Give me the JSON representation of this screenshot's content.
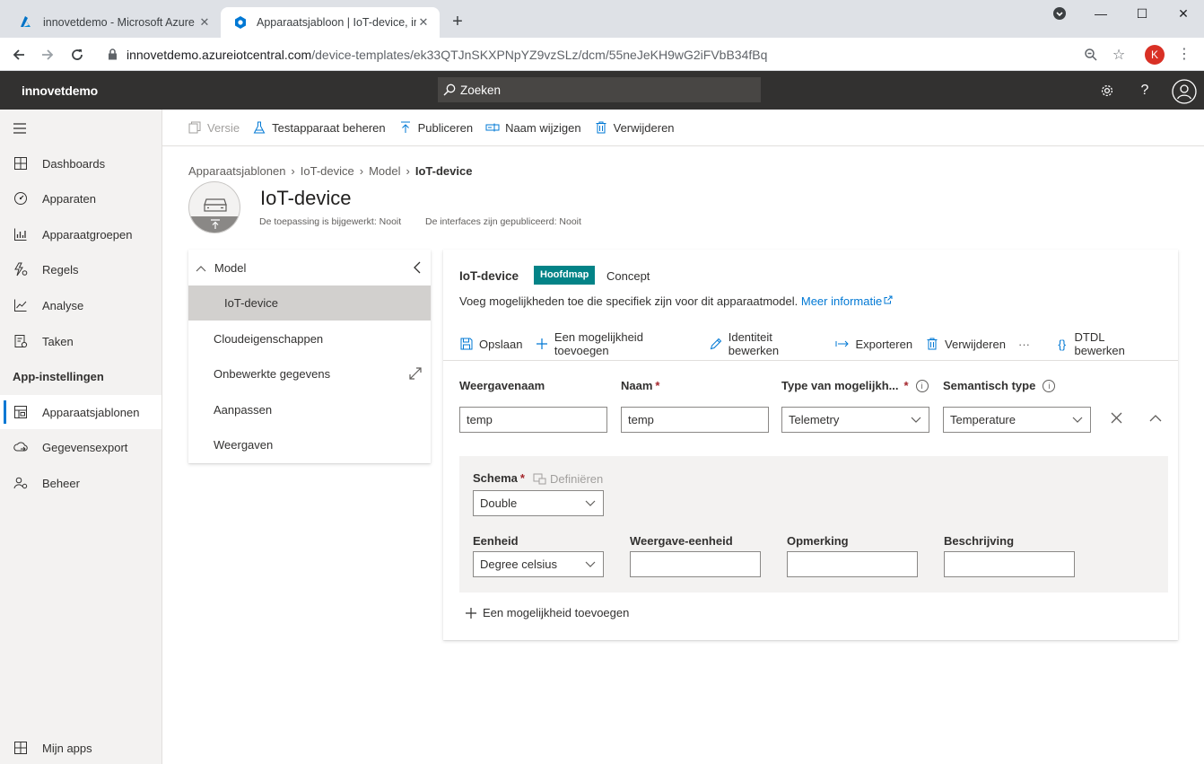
{
  "browser": {
    "tabs": [
      {
        "title": "innovetdemo - Microsoft Azure",
        "active": false
      },
      {
        "title": "Apparaatsjabloon | IoT-device, in",
        "active": true
      }
    ],
    "url_host": "innovetdemo.azureiotcentral.com",
    "url_path": "/device-templates/ek33QTJnSKXPNpYZ9vzSLz/dcm/55neJeKH9wG2iFVbB34fBq",
    "profile_initial": "K"
  },
  "app": {
    "name": "innovetdemo",
    "search_placeholder": "Zoeken"
  },
  "leftnav": {
    "items": [
      {
        "label": "Dashboards",
        "icon": "dashboard-icon"
      },
      {
        "label": "Apparaten",
        "icon": "devices-icon"
      },
      {
        "label": "Apparaatgroepen",
        "icon": "device-groups-icon"
      },
      {
        "label": "Regels",
        "icon": "rules-icon"
      },
      {
        "label": "Analyse",
        "icon": "analytics-icon"
      },
      {
        "label": "Taken",
        "icon": "jobs-icon"
      }
    ],
    "section_label": "App-instellingen",
    "settings_items": [
      {
        "label": "Apparaatsjablonen",
        "icon": "device-templates-icon",
        "selected": true
      },
      {
        "label": "Gegevensexport",
        "icon": "data-export-icon"
      },
      {
        "label": "Beheer",
        "icon": "administration-icon"
      }
    ],
    "bottom_item": "Mijn apps"
  },
  "commandbar": {
    "version": "Versie",
    "manage_test_device": "Testapparaat beheren",
    "publish": "Publiceren",
    "rename": "Naam wijzigen",
    "delete": "Verwijderen"
  },
  "breadcrumb": [
    "Apparaatsjablonen",
    "IoT-device",
    "Model",
    "IoT-device"
  ],
  "page": {
    "title": "IoT-device",
    "app_updated": "De toepassing is bijgewerkt: Nooit",
    "interfaces_published": "De interfaces zijn gepubliceerd: Nooit"
  },
  "tree": {
    "model": "Model",
    "interface": "IoT-device",
    "items": [
      "Cloudeigenschappen",
      "Onbewerkte gegevens",
      "Aanpassen",
      "Weergaven"
    ]
  },
  "card": {
    "title": "IoT-device",
    "badge": "Hoofdmap",
    "status": "Concept",
    "description": "Voeg mogelijkheden toe die specifiek zijn voor dit apparaatmodel.",
    "more_link": "Meer informatie",
    "commands": {
      "save": "Opslaan",
      "add_capability": "Een mogelijkheid toevoegen",
      "edit_identity": "Identiteit bewerken",
      "export": "Exporteren",
      "delete": "Verwijderen",
      "more": "···",
      "edit_dtdl": "DTDL bewerken"
    },
    "fields": {
      "display_name_label": "Weergavenaam",
      "name_label": "Naam",
      "capability_type_label": "Type van mogelijkh...",
      "semantic_type_label": "Semantisch type",
      "display_name_value": "temp",
      "name_value": "temp",
      "capability_type_value": "Telemetry",
      "semantic_type_value": "Temperature"
    },
    "detail": {
      "schema_label": "Schema",
      "define_label": "Definiëren",
      "schema_value": "Double",
      "unit_label": "Eenheid",
      "unit_value": "Degree celsius",
      "display_unit_label": "Weergave-eenheid",
      "display_unit_value": "",
      "comment_label": "Opmerking",
      "comment_value": "",
      "description_label": "Beschrijving",
      "description_value": ""
    },
    "add_capability_footer": "Een mogelijkheid toevoegen"
  }
}
